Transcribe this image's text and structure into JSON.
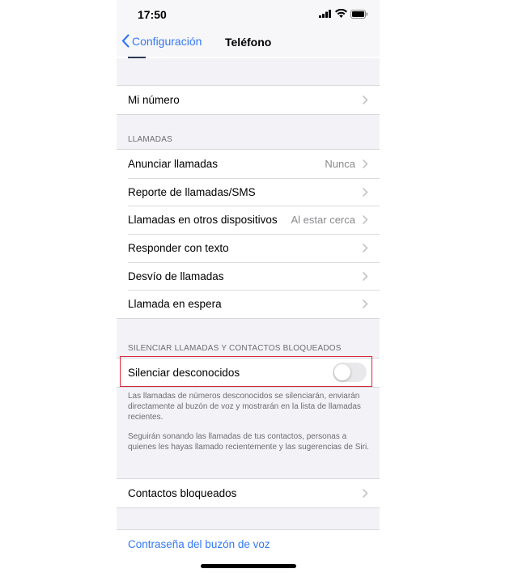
{
  "status": {
    "time": "17:50"
  },
  "nav": {
    "back_label": "Configuración",
    "title": "Teléfono"
  },
  "my_number": {
    "label": "Mi número"
  },
  "calls": {
    "header": "LLAMADAS",
    "items": [
      {
        "label": "Anunciar llamadas",
        "value": "Nunca"
      },
      {
        "label": "Reporte de llamadas/SMS",
        "value": ""
      },
      {
        "label": "Llamadas en otros dispositivos",
        "value": "Al estar cerca"
      },
      {
        "label": "Responder con texto",
        "value": ""
      },
      {
        "label": "Desvío de llamadas",
        "value": ""
      },
      {
        "label": "Llamada en espera",
        "value": ""
      }
    ]
  },
  "silence": {
    "header": "SILENCIAR LLAMADAS Y CONTACTOS BLOQUEADOS",
    "toggle_label": "Silenciar desconocidos",
    "toggle_on": false,
    "footer_1": "Las llamadas de números desconocidos se silenciarán, enviarán directamente al buzón de voz y mostrarán en la lista de llamadas recientes.",
    "footer_2": "Seguirán sonando las llamadas de tus contactos, personas a quienes les hayas llamado recientemente y las sugerencias de Siri."
  },
  "blocked": {
    "label": "Contactos bloqueados"
  },
  "voicemail": {
    "label": "Contraseña del buzón de voz"
  },
  "colors": {
    "accent": "#3478f6",
    "highlight": "#d9263a",
    "background": "#f2f2f7"
  }
}
